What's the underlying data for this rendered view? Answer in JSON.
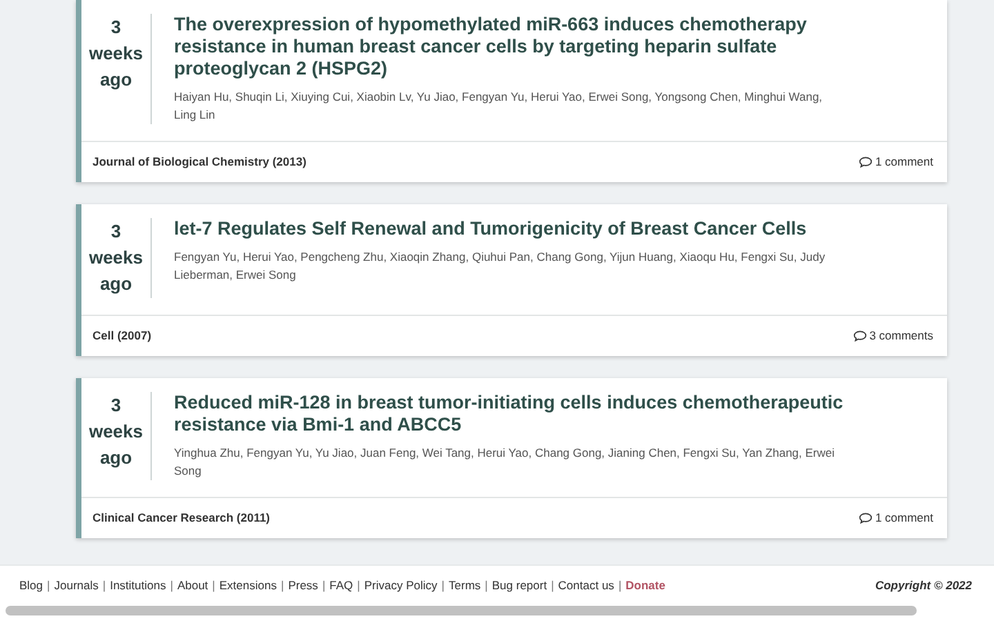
{
  "papers": [
    {
      "age": [
        "3",
        "weeks",
        "ago"
      ],
      "title": "The overexpression of hypomethylated miR-663 induces chemotherapy resistance in human breast cancer cells by targeting heparin sulfate proteoglycan 2 (HSPG2)",
      "authors": "Haiyan Hu, Shuqin Li, Xiuying Cui, Xiaobin Lv, Yu Jiao, Fengyan Yu, Herui Yao, Erwei Song, Yongsong Chen, Minghui Wang, Ling Lin",
      "journal": "Journal of Biological Chemistry (2013)",
      "comments": "1 comment"
    },
    {
      "age": [
        "3",
        "weeks",
        "ago"
      ],
      "title": "let-7 Regulates Self Renewal and Tumorigenicity of Breast Cancer Cells",
      "authors": "Fengyan Yu, Herui Yao, Pengcheng Zhu, Xiaoqin Zhang, Qiuhui Pan, Chang Gong, Yijun Huang, Xiaoqu Hu, Fengxi Su, Judy Lieberman, Erwei Song",
      "journal": "Cell (2007)",
      "comments": "3 comments"
    },
    {
      "age": [
        "3",
        "weeks",
        "ago"
      ],
      "title": "Reduced miR-128 in breast tumor-initiating cells induces chemotherapeutic resistance via Bmi-1 and ABCC5",
      "authors": "Yinghua Zhu, Fengyan Yu, Yu Jiao, Juan Feng, Wei Tang, Herui Yao, Chang Gong, Jianing Chen, Fengxi Su, Yan Zhang, Erwei Song",
      "journal": "Clinical Cancer Research (2011)",
      "comments": "1 comment"
    }
  ],
  "footer": {
    "links": [
      {
        "label": "Blog",
        "kind": "link"
      },
      {
        "label": "Journals",
        "kind": "link"
      },
      {
        "label": "Institutions",
        "kind": "link"
      },
      {
        "label": "About",
        "kind": "link"
      },
      {
        "label": "Extensions",
        "kind": "link"
      },
      {
        "label": "Press",
        "kind": "link"
      },
      {
        "label": "FAQ",
        "kind": "link"
      },
      {
        "label": "Privacy Policy",
        "kind": "link"
      },
      {
        "label": "Terms",
        "kind": "link"
      },
      {
        "label": "Bug report",
        "kind": "link"
      },
      {
        "label": "Contact us",
        "kind": "link"
      },
      {
        "label": "Donate",
        "kind": "donate"
      }
    ],
    "separator": "|",
    "copyright": "Copyright © 2022"
  }
}
